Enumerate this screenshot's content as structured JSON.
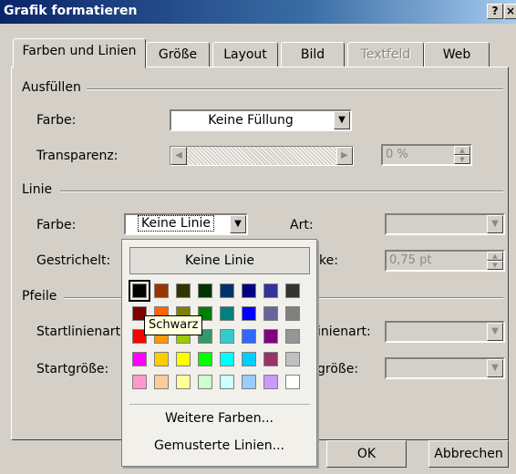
{
  "window": {
    "title": "Grafik formatieren",
    "help_label": "?",
    "close_label": "×"
  },
  "tabs": [
    {
      "label": "Farben und Linien",
      "active": true
    },
    {
      "label": "Größe"
    },
    {
      "label": "Layout"
    },
    {
      "label": "Bild"
    },
    {
      "label": "Textfeld",
      "disabled": true
    },
    {
      "label": "Web"
    }
  ],
  "fill": {
    "group_label": "Ausfüllen",
    "color_label": "Farbe:",
    "color_value": "Keine Füllung",
    "transparency_label": "Transparenz:",
    "transparency_value": "0 %"
  },
  "line": {
    "group_label": "Linie",
    "color_label": "Farbe:",
    "color_value": "Keine Linie",
    "dashed_label": "Gestrichelt:",
    "type_label": "Art:",
    "weight_label": "ke:",
    "weight_value": "0,75 pt"
  },
  "arrows": {
    "group_label": "Pfeile",
    "start_style_label": "Startlinienart:",
    "end_style_label": "inienart:",
    "start_size_label": "Startgröße:",
    "end_size_label": "größe:"
  },
  "color_popup": {
    "no_line_label": "Keine Linie",
    "more_colors_label": "Weitere Farben...",
    "patterned_lines_label": "Gemusterte Linien...",
    "tooltip": "Schwarz",
    "palette": [
      [
        "#000000",
        "#993300",
        "#333300",
        "#003300",
        "#003366",
        "#000080",
        "#333399",
        "#333333"
      ],
      [
        "#800000",
        "#FF6600",
        "#808000",
        "#008000",
        "#008080",
        "#0000FF",
        "#666699",
        "#808080"
      ],
      [
        "#FF0000",
        "#FF9900",
        "#99CC00",
        "#339966",
        "#33CCCC",
        "#3366FF",
        "#800080",
        "#969696"
      ],
      [
        "#FF00FF",
        "#FFCC00",
        "#FFFF00",
        "#00FF00",
        "#00FFFF",
        "#00CCFF",
        "#993366",
        "#C0C0C0"
      ],
      [
        "#FF99CC",
        "#FFCC99",
        "#FFFF99",
        "#CCFFCC",
        "#CCFFFF",
        "#99CCFF",
        "#CC99FF",
        "#FFFFFF"
      ]
    ],
    "selected_color": "#000000"
  },
  "buttons": {
    "ok_label": "OK",
    "cancel_label": "Abbrechen"
  }
}
